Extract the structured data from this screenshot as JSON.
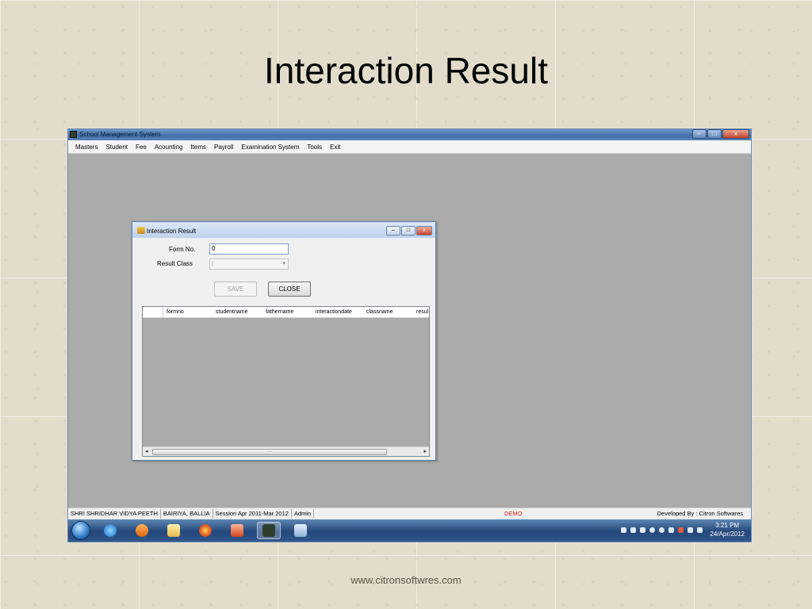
{
  "slide": {
    "title": "Interaction Result",
    "footer": "www.citronsoftwres.com"
  },
  "app": {
    "title": "School Management System",
    "menu": [
      "Masters",
      "Student",
      "Fee",
      "Acounting",
      "Items",
      "Payroll",
      "Examination System",
      "Tools",
      "Exit"
    ],
    "window_buttons": {
      "minimize": "–",
      "maximize": "□",
      "close": "x"
    }
  },
  "dialog": {
    "title": "Interaction Result",
    "form_no_label": "Form No.",
    "form_no_value": "0",
    "result_class_label": "Result Class",
    "result_class_value": "|",
    "save_label": "SAVE",
    "close_label": "CLOSE",
    "grid_columns": [
      "formno",
      "studentname",
      "fathername",
      "interactiondate",
      "classname",
      "resul"
    ],
    "buttons": {
      "minimize": "–",
      "maximize": "□",
      "close": "x"
    }
  },
  "status": {
    "school": "SHRI SHRIDHAR VIDYA PEETH",
    "location": "BAIRIYA, BALLIA",
    "session": "Session Apr 2011-Mar 2012",
    "user": "Admin",
    "demo": "DEMO",
    "developer": "Developed By : Citron Softwares"
  },
  "taskbar": {
    "icons": [
      "internet-explorer-icon",
      "media-player-icon",
      "file-explorer-icon",
      "firefox-icon",
      "presentation-icon",
      "school-app-icon",
      "paint-icon"
    ],
    "time": "3:21 PM",
    "date": "24/Apr/2012"
  },
  "colors": {
    "status_demo": "#dd2222",
    "taskbar": "#24477a",
    "desktop": "#ababab"
  }
}
